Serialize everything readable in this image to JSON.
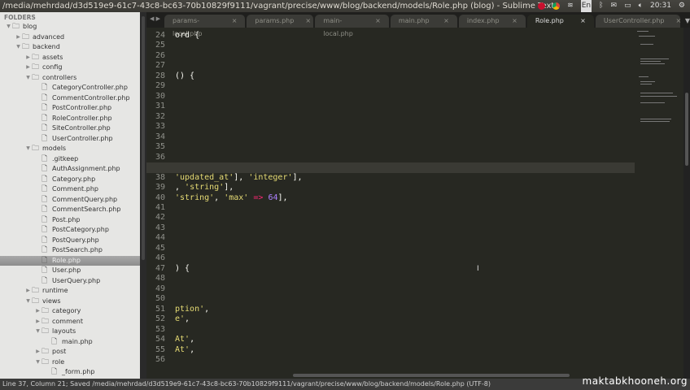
{
  "window": {
    "title": "/media/mehrdad/d3d519e9-61c7-43c8-bc63-70b10829f9111/vagrant/precise/www/blog/backend/models/Role.php (blog) - Sublime Text",
    "clock": "20:31",
    "keyboard": "En"
  },
  "sidebar": {
    "header": "FOLDERS",
    "items": [
      {
        "label": "blog",
        "level": 0,
        "type": "folder",
        "open": true
      },
      {
        "label": "advanced",
        "level": 1,
        "type": "folder",
        "open": false
      },
      {
        "label": "backend",
        "level": 1,
        "type": "folder",
        "open": true
      },
      {
        "label": "assets",
        "level": 2,
        "type": "folder",
        "open": false
      },
      {
        "label": "config",
        "level": 2,
        "type": "folder",
        "open": false
      },
      {
        "label": "controllers",
        "level": 2,
        "type": "folder",
        "open": true
      },
      {
        "label": "CategoryController.php",
        "level": 3,
        "type": "file"
      },
      {
        "label": "CommentController.php",
        "level": 3,
        "type": "file"
      },
      {
        "label": "PostController.php",
        "level": 3,
        "type": "file"
      },
      {
        "label": "RoleController.php",
        "level": 3,
        "type": "file"
      },
      {
        "label": "SiteController.php",
        "level": 3,
        "type": "file"
      },
      {
        "label": "UserController.php",
        "level": 3,
        "type": "file"
      },
      {
        "label": "models",
        "level": 2,
        "type": "folder",
        "open": true
      },
      {
        "label": ".gitkeep",
        "level": 3,
        "type": "file"
      },
      {
        "label": "AuthAssignment.php",
        "level": 3,
        "type": "file"
      },
      {
        "label": "Category.php",
        "level": 3,
        "type": "file"
      },
      {
        "label": "Comment.php",
        "level": 3,
        "type": "file"
      },
      {
        "label": "CommentQuery.php",
        "level": 3,
        "type": "file"
      },
      {
        "label": "CommentSearch.php",
        "level": 3,
        "type": "file"
      },
      {
        "label": "Post.php",
        "level": 3,
        "type": "file"
      },
      {
        "label": "PostCategory.php",
        "level": 3,
        "type": "file"
      },
      {
        "label": "PostQuery.php",
        "level": 3,
        "type": "file"
      },
      {
        "label": "PostSearch.php",
        "level": 3,
        "type": "file"
      },
      {
        "label": "Role.php",
        "level": 3,
        "type": "file",
        "selected": true
      },
      {
        "label": "User.php",
        "level": 3,
        "type": "file"
      },
      {
        "label": "UserQuery.php",
        "level": 3,
        "type": "file"
      },
      {
        "label": "runtime",
        "level": 2,
        "type": "folder",
        "open": false
      },
      {
        "label": "views",
        "level": 2,
        "type": "folder",
        "open": true
      },
      {
        "label": "category",
        "level": 3,
        "type": "folder",
        "open": false
      },
      {
        "label": "comment",
        "level": 3,
        "type": "folder",
        "open": false
      },
      {
        "label": "layouts",
        "level": 3,
        "type": "folder",
        "open": true
      },
      {
        "label": "main.php",
        "level": 4,
        "type": "file"
      },
      {
        "label": "post",
        "level": 3,
        "type": "folder",
        "open": false
      },
      {
        "label": "role",
        "level": 3,
        "type": "folder",
        "open": true
      },
      {
        "label": "_form.php",
        "level": 4,
        "type": "file"
      }
    ]
  },
  "tabs": [
    {
      "label": "params-local.php"
    },
    {
      "label": "params.php"
    },
    {
      "label": "main-local.php"
    },
    {
      "label": "main.php"
    },
    {
      "label": "index.php"
    },
    {
      "label": "Role.php",
      "active": true
    },
    {
      "label": "UserController.php"
    }
  ],
  "editor": {
    "first_line": 24,
    "last_line": 56,
    "current_line": 37,
    "lines": {
      "24": [
        [
          "p",
          "ord {"
        ]
      ],
      "28": [
        [
          "p",
          "() {"
        ]
      ],
      "38": [
        [
          "s",
          "'updated_at'"
        ],
        [
          "p",
          "], "
        ],
        [
          "s",
          "'integer'"
        ],
        [
          "p",
          "],"
        ]
      ],
      "39": [
        [
          "p",
          ", "
        ],
        [
          "s",
          "'string'"
        ],
        [
          "p",
          "],"
        ]
      ],
      "40": [
        [
          "s",
          "'string'"
        ],
        [
          "p",
          ", "
        ],
        [
          "s",
          "'max'"
        ],
        [
          "p",
          " "
        ],
        [
          "k",
          "=>"
        ],
        [
          "p",
          " "
        ],
        [
          "n",
          "64"
        ],
        [
          "p",
          "],"
        ]
      ],
      "47": [
        [
          "p",
          ") {"
        ]
      ],
      "51": [
        [
          "s",
          "ption'"
        ],
        [
          "p",
          ","
        ]
      ],
      "52": [
        [
          "s",
          "e'"
        ],
        [
          "p",
          ","
        ]
      ],
      "54": [
        [
          "s",
          "At'"
        ],
        [
          "p",
          ","
        ]
      ],
      "55": [
        [
          "s",
          "At'"
        ],
        [
          "p",
          ","
        ]
      ]
    }
  },
  "status": {
    "text": "Line 37, Column 21; Saved /media/mehrdad/d3d519e9-61c7-43c8-bc63-70b10829f9111/vagrant/precise/www/blog/backend/models/Role.php (UTF-8)"
  },
  "watermark": "maktabkhooneh.org"
}
